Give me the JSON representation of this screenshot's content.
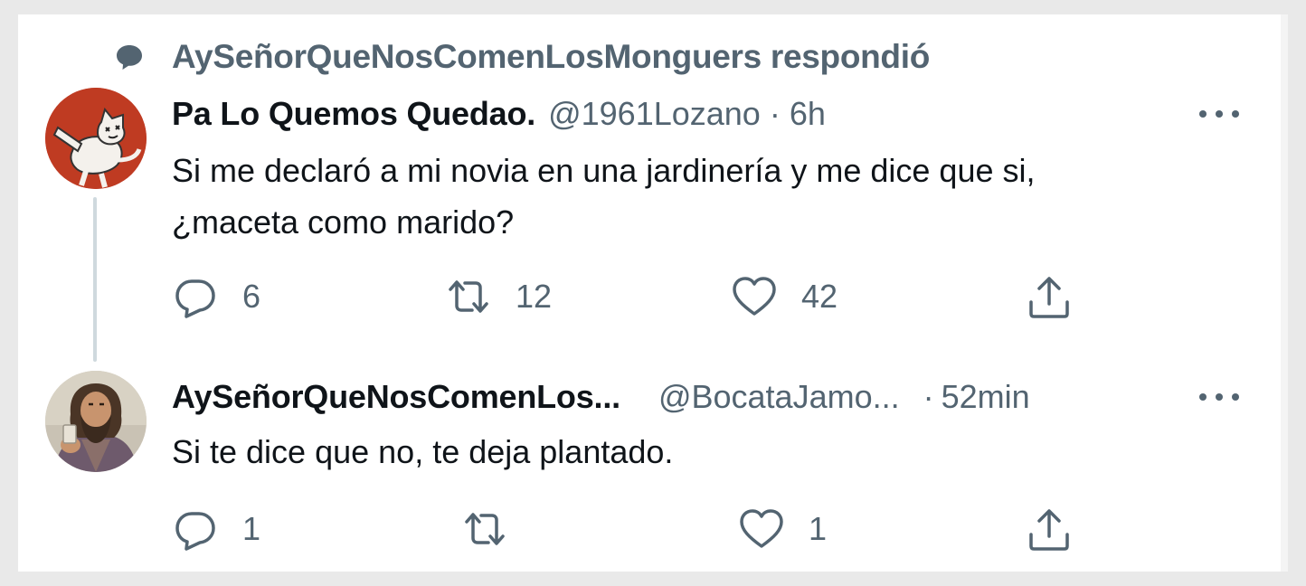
{
  "context": {
    "icon": "reply-bubble-icon",
    "text": "AySeñorQueNosComenLosMonguers respondió"
  },
  "tweets": [
    {
      "display_name": "Pa Lo Quemos Quedao.",
      "handle": "@1961Lozano",
      "separator": "·",
      "time": "6h",
      "text_line1": "Si me declaró a mi novia en una jardinería y me dice que si,",
      "text_line2": "¿maceta como marido?",
      "avatar": "cartoon-cat-avatar",
      "actions": {
        "reply_count": "6",
        "retweet_count": "12",
        "like_count": "42",
        "share_count": ""
      }
    },
    {
      "display_name": "AySeñorQueNosComenLos...",
      "handle": "@BocataJamo...",
      "separator": "·",
      "time": "52min",
      "text_line1": "Si te dice que no, te deja plantado.",
      "avatar": "bearded-man-avatar",
      "actions": {
        "reply_count": "1",
        "retweet_count": "",
        "like_count": "1",
        "share_count": ""
      }
    }
  ],
  "colors": {
    "text_primary": "#0f1419",
    "text_secondary": "#536471",
    "thread_line": "#cfd9de",
    "background": "#e9e9e9"
  }
}
